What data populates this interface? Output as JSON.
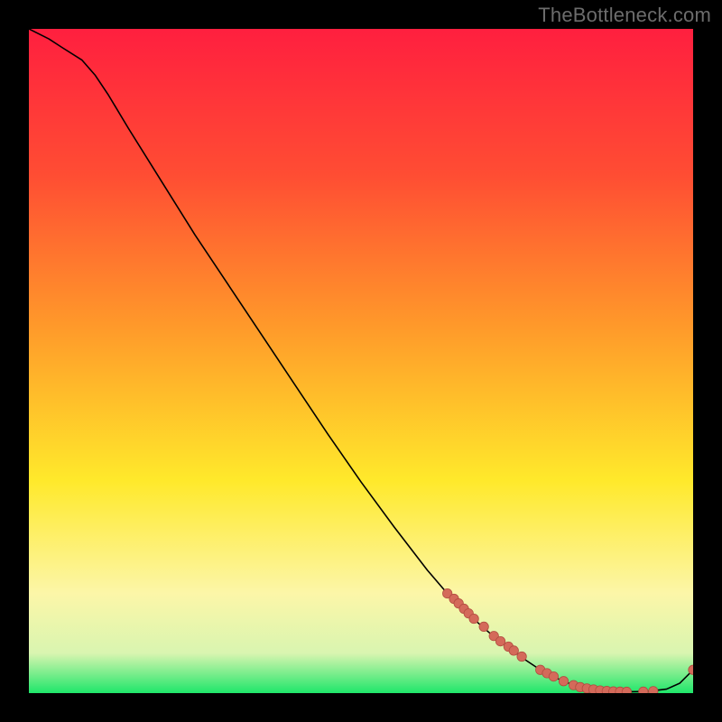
{
  "watermark": "TheBottleneck.com",
  "colors": {
    "bg_black": "#000000",
    "grad_red": "#ff1f3f",
    "grad_orange": "#ff8a2a",
    "grad_yellow": "#ffe92b",
    "grad_cream": "#fbf8c8",
    "grad_green": "#1fe66a",
    "curve_stroke": "#000000",
    "marker_fill": "#d46a5a",
    "marker_stroke": "#b24d40",
    "watermark_text": "#6c6c6c"
  },
  "chart_data": {
    "type": "line",
    "title": "",
    "xlabel": "",
    "ylabel": "",
    "xlim": [
      0,
      100
    ],
    "ylim": [
      0,
      100
    ],
    "series": [
      {
        "name": "curve",
        "x": [
          0,
          3,
          5,
          8,
          10,
          12,
          15,
          20,
          25,
          30,
          35,
          40,
          45,
          50,
          55,
          60,
          63,
          66,
          70,
          74,
          77,
          80,
          82,
          84,
          86,
          88,
          90,
          93,
          96,
          98,
          100
        ],
        "y": [
          100,
          98.5,
          97.2,
          95.3,
          93.0,
          90.0,
          85.0,
          77.0,
          69.0,
          61.5,
          54.0,
          46.5,
          39.0,
          31.8,
          25.0,
          18.5,
          15.0,
          12.0,
          8.5,
          5.5,
          3.5,
          2.0,
          1.2,
          0.7,
          0.4,
          0.25,
          0.2,
          0.25,
          0.6,
          1.5,
          3.5
        ]
      }
    ],
    "markers": {
      "name": "points",
      "x": [
        63.0,
        64.0,
        64.7,
        65.5,
        66.2,
        67.0,
        68.5,
        70.0,
        71.0,
        72.2,
        73.0,
        74.2,
        77.0,
        78.0,
        79.0,
        80.5,
        82.0,
        83.0,
        84.0,
        85.0,
        86.0,
        87.0,
        88.0,
        89.0,
        90.0,
        92.5,
        94.0,
        100.0
      ],
      "y": [
        15.0,
        14.2,
        13.5,
        12.7,
        12.0,
        11.2,
        10.0,
        8.6,
        7.8,
        7.0,
        6.4,
        5.5,
        3.5,
        3.0,
        2.5,
        1.8,
        1.2,
        0.9,
        0.7,
        0.55,
        0.4,
        0.32,
        0.25,
        0.22,
        0.2,
        0.22,
        0.3,
        3.5
      ]
    }
  }
}
